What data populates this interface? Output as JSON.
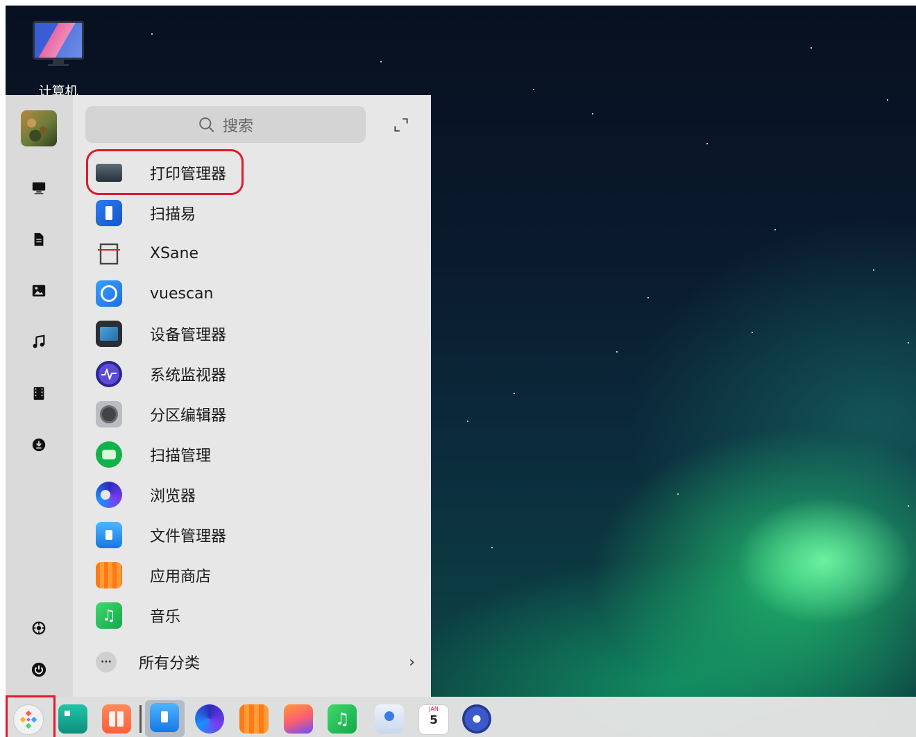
{
  "desktop": {
    "icons": [
      {
        "label": "计算机",
        "icon": "computer-monitor-icon"
      }
    ]
  },
  "start_menu": {
    "search": {
      "placeholder": "搜索"
    },
    "sidebar": [
      "user-avatar",
      "computer-icon",
      "document-icon",
      "picture-icon",
      "music-icon",
      "video-icon",
      "download-icon",
      "settings-icon",
      "power-icon"
    ],
    "apps": [
      {
        "label": "打印管理器",
        "icon": "printer-icon",
        "highlighted": true
      },
      {
        "label": "扫描易",
        "icon": "scanner-easy-icon"
      },
      {
        "label": "XSane",
        "icon": "xsane-icon"
      },
      {
        "label": "vuescan",
        "icon": "vuescan-icon"
      },
      {
        "label": "设备管理器",
        "icon": "device-manager-icon"
      },
      {
        "label": "系统监视器",
        "icon": "system-monitor-icon"
      },
      {
        "label": "分区编辑器",
        "icon": "partition-editor-icon"
      },
      {
        "label": "扫描管理",
        "icon": "scan-manager-icon"
      },
      {
        "label": "浏览器",
        "icon": "browser-icon"
      },
      {
        "label": "文件管理器",
        "icon": "file-manager-icon"
      },
      {
        "label": "应用商店",
        "icon": "app-store-icon"
      },
      {
        "label": "音乐",
        "icon": "music-app-icon"
      }
    ],
    "all_categories": {
      "label": "所有分类",
      "chevron": "›"
    }
  },
  "taskbar": {
    "calendar": {
      "month": "JAN",
      "day": "5"
    },
    "items": [
      "launcher-icon",
      "multitask-view-icon",
      "workspace-icon",
      "file-manager-icon",
      "browser-icon",
      "app-store-icon",
      "image-viewer-icon",
      "music-icon",
      "contacts-icon",
      "calendar-icon",
      "settings-icon"
    ]
  },
  "colors": {
    "highlight": "#e0192b",
    "menu_bg": "#e7e7e7",
    "sidebar_bg": "#dadada"
  }
}
